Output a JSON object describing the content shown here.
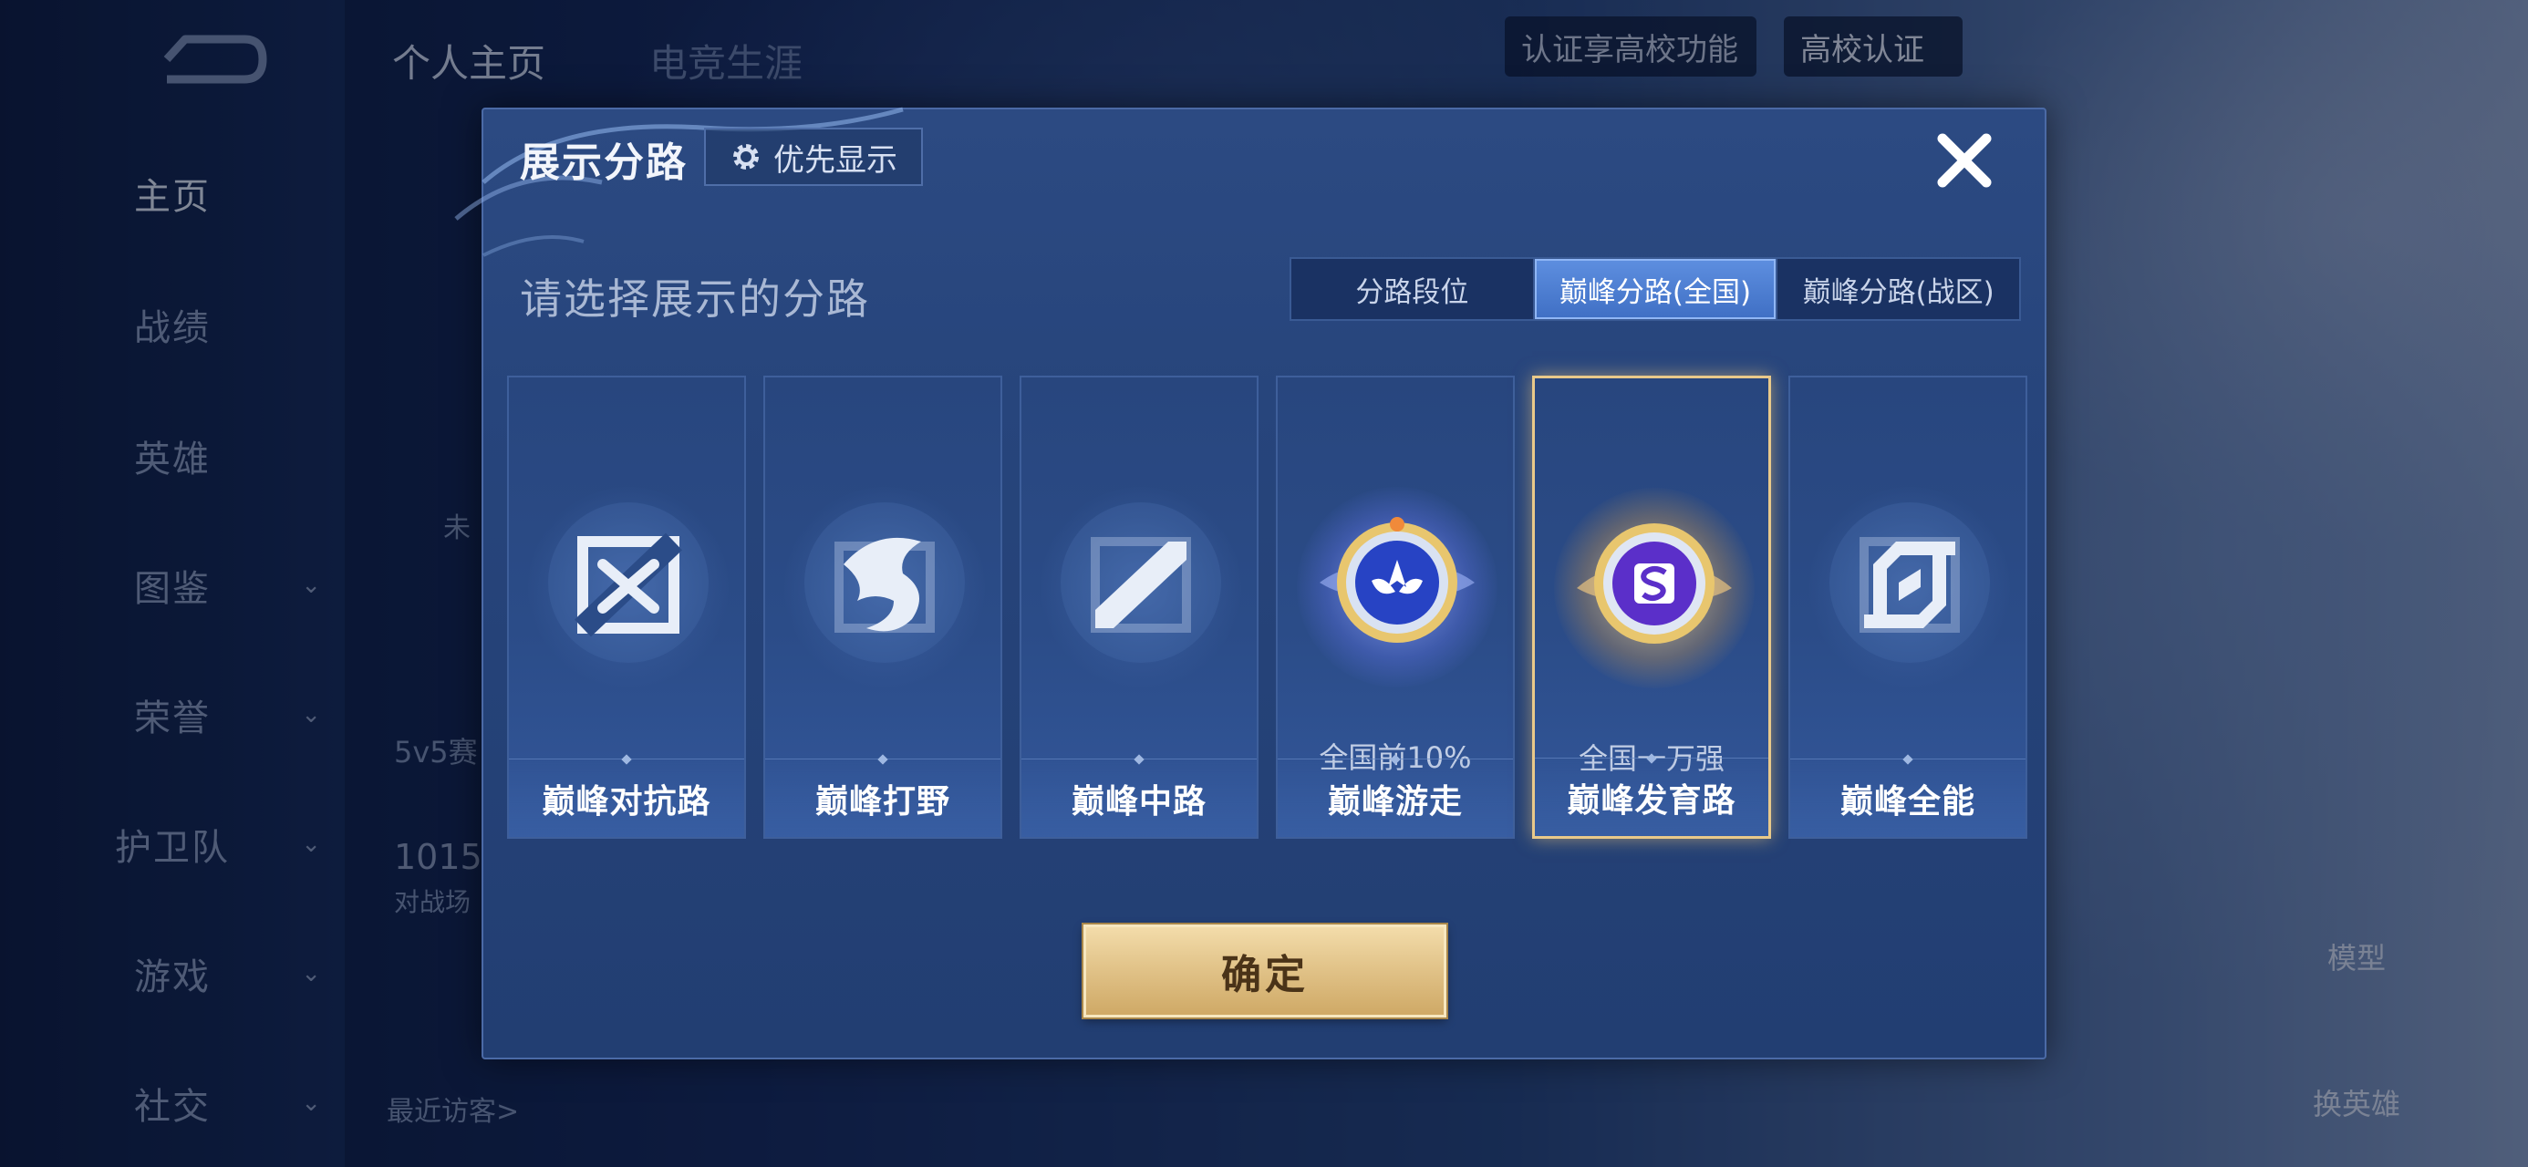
{
  "sidebar": {
    "items": [
      {
        "label": "主页",
        "has_chevron": false
      },
      {
        "label": "战绩",
        "has_chevron": false
      },
      {
        "label": "英雄",
        "has_chevron": false
      },
      {
        "label": "图鉴",
        "has_chevron": true
      },
      {
        "label": "荣誉",
        "has_chevron": true
      },
      {
        "label": "护卫队",
        "has_chevron": true
      },
      {
        "label": "游戏",
        "has_chevron": true
      },
      {
        "label": "社交",
        "has_chevron": true
      }
    ],
    "active_index": 0
  },
  "top_bar": {
    "tabs": [
      "个人主页",
      "电竞生涯"
    ],
    "campus_prompt": "认证享高校功能",
    "campus_button": "高校认证"
  },
  "background_text": {
    "mode_partial": "5v5赛",
    "count_partial": "1015",
    "count_label_partial": "对战场",
    "status_partial": "未",
    "recent_visitors": "最近访客>",
    "model_label": "模型",
    "switch_hero_label": "换英雄"
  },
  "modal": {
    "title": "展示分路",
    "priority_button": "优先显示",
    "subtitle": "请选择展示的分路",
    "segments": [
      "分路段位",
      "巅峰分路(全国)",
      "巅峰分路(战区)"
    ],
    "active_segment": 1,
    "lanes": [
      {
        "name": "巅峰对抗路",
        "badge": "",
        "emblem": "clash-lane-icon"
      },
      {
        "name": "巅峰打野",
        "badge": "",
        "emblem": "jungle-dragon-icon"
      },
      {
        "name": "巅峰中路",
        "badge": "",
        "emblem": "mid-lane-icon"
      },
      {
        "name": "巅峰游走",
        "badge": "全国前10%",
        "emblem": "roam-rank-emblem"
      },
      {
        "name": "巅峰发育路",
        "badge": "全国一万强",
        "emblem": "farm-lane-rank-emblem"
      },
      {
        "name": "巅峰全能",
        "badge": "",
        "emblem": "all-round-icon"
      }
    ],
    "selected_lane": 4,
    "confirm_button": "确定"
  },
  "colors": {
    "accent_blue": "#4a7bd0",
    "gold": "#e2c48a",
    "panel": "#27457c"
  }
}
